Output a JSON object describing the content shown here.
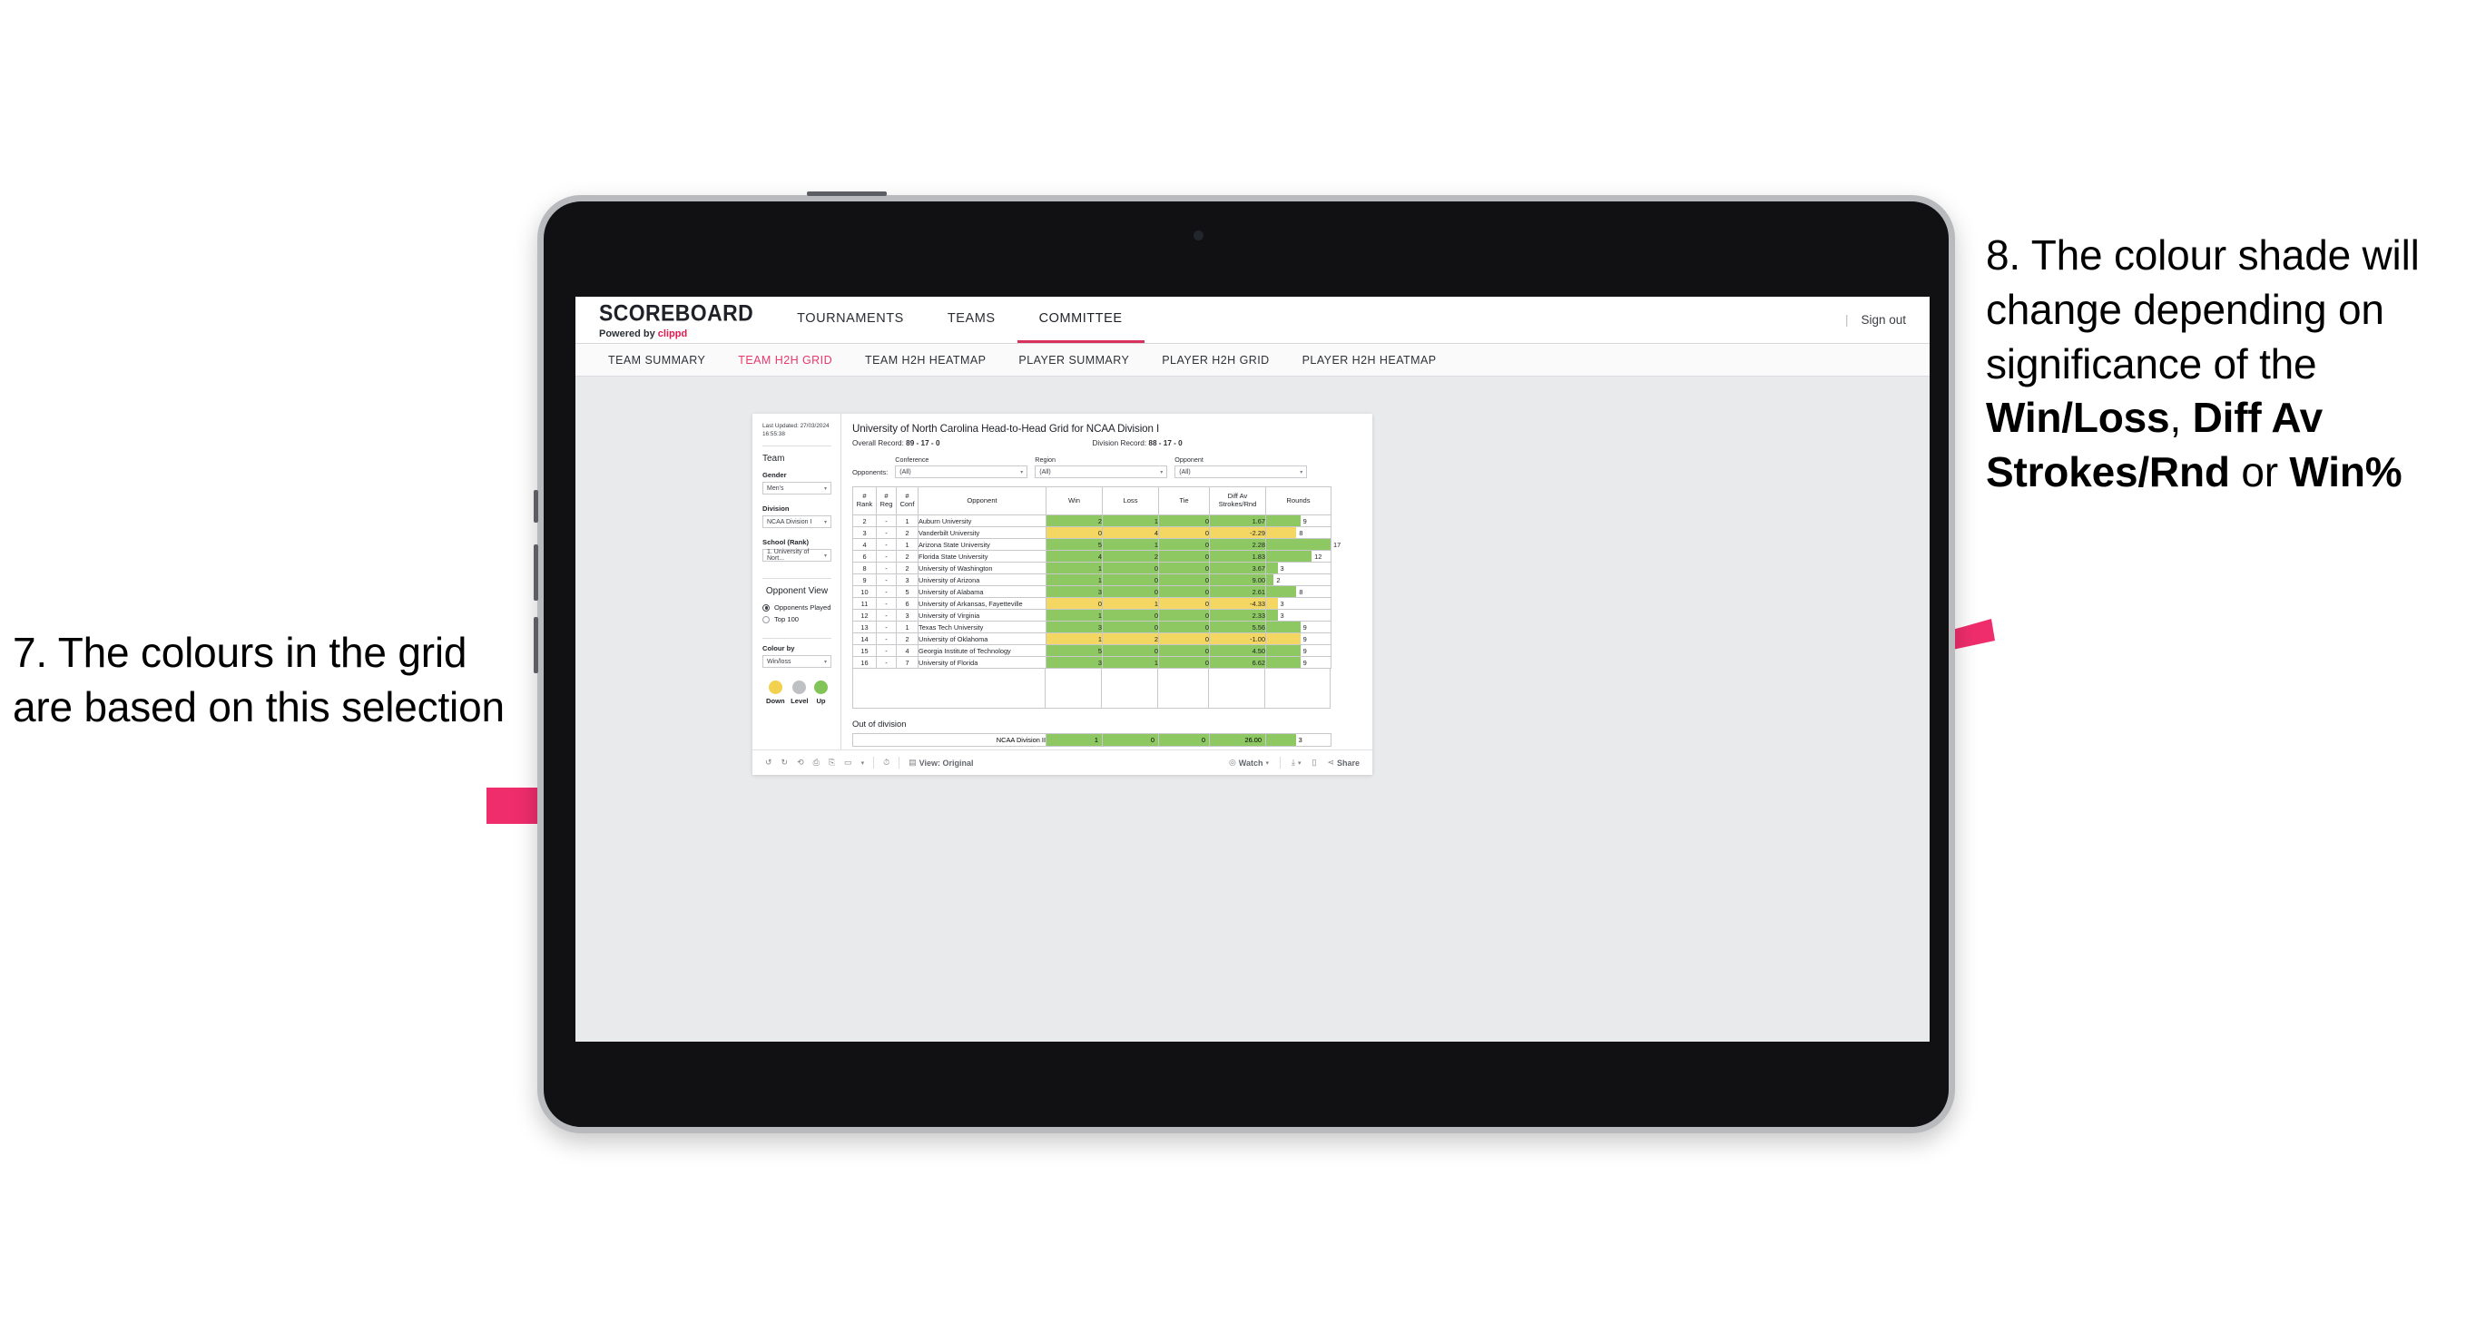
{
  "annotations": {
    "left": "7. The colours in the grid are based on this selection",
    "right_pre": "8. The colour shade will change depending on significance of the ",
    "right_b1": "Win/Loss",
    "right_mid1": ", ",
    "right_b2": "Diff Av Strokes/Rnd",
    "right_mid2": " or ",
    "right_b3": "Win%"
  },
  "app": {
    "brand_title": "SCOREBOARD",
    "brand_sub_prefix": "Powered by ",
    "brand_sub_clippd": "clippd",
    "top_nav": [
      {
        "label": "TOURNAMENTS",
        "active": false
      },
      {
        "label": "TEAMS",
        "active": false
      },
      {
        "label": "COMMITTEE",
        "active": true
      }
    ],
    "sign_out": "Sign out",
    "divider": "|",
    "sub_nav": [
      {
        "label": "TEAM SUMMARY",
        "active": false
      },
      {
        "label": "TEAM H2H GRID",
        "active": true
      },
      {
        "label": "TEAM H2H HEATMAP",
        "active": false
      },
      {
        "label": "PLAYER SUMMARY",
        "active": false
      },
      {
        "label": "PLAYER H2H GRID",
        "active": false
      },
      {
        "label": "PLAYER H2H HEATMAP",
        "active": false
      }
    ]
  },
  "sidebar": {
    "last_updated": "Last Updated: 27/03/2024 16:55:38",
    "team_heading": "Team",
    "gender_label": "Gender",
    "gender_value": "Men's",
    "division_label": "Division",
    "division_value": "NCAA Division I",
    "school_label": "School (Rank)",
    "school_value": "1. University of Nort...",
    "opponent_view_heading": "Opponent View",
    "opponent_view_options": [
      {
        "label": "Opponents Played",
        "selected": true
      },
      {
        "label": "Top 100",
        "selected": false
      }
    ],
    "colour_by_label": "Colour by",
    "colour_by_value": "Win/loss",
    "legend": [
      {
        "label": "Down",
        "color": "#f2d14f"
      },
      {
        "label": "Level",
        "color": "#bfc0c4"
      },
      {
        "label": "Up",
        "color": "#82c458"
      }
    ]
  },
  "viz": {
    "title": "University of North Carolina Head-to-Head Grid for NCAA Division I",
    "overall_record_label": "Overall Record:",
    "overall_record_value": "89 - 17 - 0",
    "division_record_label": "Division Record:",
    "division_record_value": "88 - 17 - 0",
    "opponents_label": "Opponents:",
    "filters": [
      {
        "label": "Conference",
        "value": "(All)"
      },
      {
        "label": "Region",
        "value": "(All)"
      },
      {
        "label": "Opponent",
        "value": "(All)"
      }
    ],
    "out_of_division_heading": "Out of division"
  },
  "chart_data": {
    "type": "table",
    "title": "University of North Carolina Head-to-Head Grid for NCAA Division I",
    "columns": [
      "# Rank",
      "# Reg",
      "# Conf",
      "Opponent",
      "Win",
      "Loss",
      "Tie",
      "Diff Av Strokes/Rnd",
      "Rounds"
    ],
    "colour_by": "Win/loss",
    "colors": {
      "up": "#8dc863",
      "down": "#f4d762",
      "level": "#bfc0c4"
    },
    "rounds_max": 17,
    "rows": [
      {
        "rank": "2",
        "reg": "-",
        "conf": "1",
        "opponent": "Auburn University",
        "win": "2",
        "loss": "1",
        "tie": "0",
        "diff": "1.67",
        "rounds": "9",
        "shade": "up"
      },
      {
        "rank": "3",
        "reg": "-",
        "conf": "2",
        "opponent": "Vanderbilt University",
        "win": "0",
        "loss": "4",
        "tie": "0",
        "diff": "-2.29",
        "rounds": "8",
        "shade": "down"
      },
      {
        "rank": "4",
        "reg": "-",
        "conf": "1",
        "opponent": "Arizona State University",
        "win": "5",
        "loss": "1",
        "tie": "0",
        "diff": "2.28",
        "rounds": "17",
        "shade": "up"
      },
      {
        "rank": "6",
        "reg": "-",
        "conf": "2",
        "opponent": "Florida State University",
        "win": "4",
        "loss": "2",
        "tie": "0",
        "diff": "1.83",
        "rounds": "12",
        "shade": "up"
      },
      {
        "rank": "8",
        "reg": "-",
        "conf": "2",
        "opponent": "University of Washington",
        "win": "1",
        "loss": "0",
        "tie": "0",
        "diff": "3.67",
        "rounds": "3",
        "shade": "up"
      },
      {
        "rank": "9",
        "reg": "-",
        "conf": "3",
        "opponent": "University of Arizona",
        "win": "1",
        "loss": "0",
        "tie": "0",
        "diff": "9.00",
        "rounds": "2",
        "shade": "up"
      },
      {
        "rank": "10",
        "reg": "-",
        "conf": "5",
        "opponent": "University of Alabama",
        "win": "3",
        "loss": "0",
        "tie": "0",
        "diff": "2.61",
        "rounds": "8",
        "shade": "up"
      },
      {
        "rank": "11",
        "reg": "-",
        "conf": "6",
        "opponent": "University of Arkansas, Fayetteville",
        "win": "0",
        "loss": "1",
        "tie": "0",
        "diff": "-4.33",
        "rounds": "3",
        "shade": "down"
      },
      {
        "rank": "12",
        "reg": "-",
        "conf": "3",
        "opponent": "University of Virginia",
        "win": "1",
        "loss": "0",
        "tie": "0",
        "diff": "2.33",
        "rounds": "3",
        "shade": "up"
      },
      {
        "rank": "13",
        "reg": "-",
        "conf": "1",
        "opponent": "Texas Tech University",
        "win": "3",
        "loss": "0",
        "tie": "0",
        "diff": "5.56",
        "rounds": "9",
        "shade": "up"
      },
      {
        "rank": "14",
        "reg": "-",
        "conf": "2",
        "opponent": "University of Oklahoma",
        "win": "1",
        "loss": "2",
        "tie": "0",
        "diff": "-1.00",
        "rounds": "9",
        "shade": "down"
      },
      {
        "rank": "15",
        "reg": "-",
        "conf": "4",
        "opponent": "Georgia Institute of Technology",
        "win": "5",
        "loss": "0",
        "tie": "0",
        "diff": "4.50",
        "rounds": "9",
        "shade": "up"
      },
      {
        "rank": "16",
        "reg": "-",
        "conf": "7",
        "opponent": "University of Florida",
        "win": "3",
        "loss": "1",
        "tie": "0",
        "diff": "6.62",
        "rounds": "9",
        "shade": "up"
      }
    ],
    "out_of_division_rows": [
      {
        "opponent": "NCAA Division II",
        "win": "1",
        "loss": "0",
        "tie": "0",
        "diff": "26.00",
        "rounds": "3",
        "shade": "up"
      }
    ]
  },
  "toolbar": {
    "undo": "undo-icon",
    "redo": "redo-icon",
    "revert": "revert-icon",
    "refresh": "refresh-icon",
    "pause": "pause-icon",
    "view_original_label": "View: Original",
    "watch_label": "Watch",
    "share_label": "Share"
  }
}
